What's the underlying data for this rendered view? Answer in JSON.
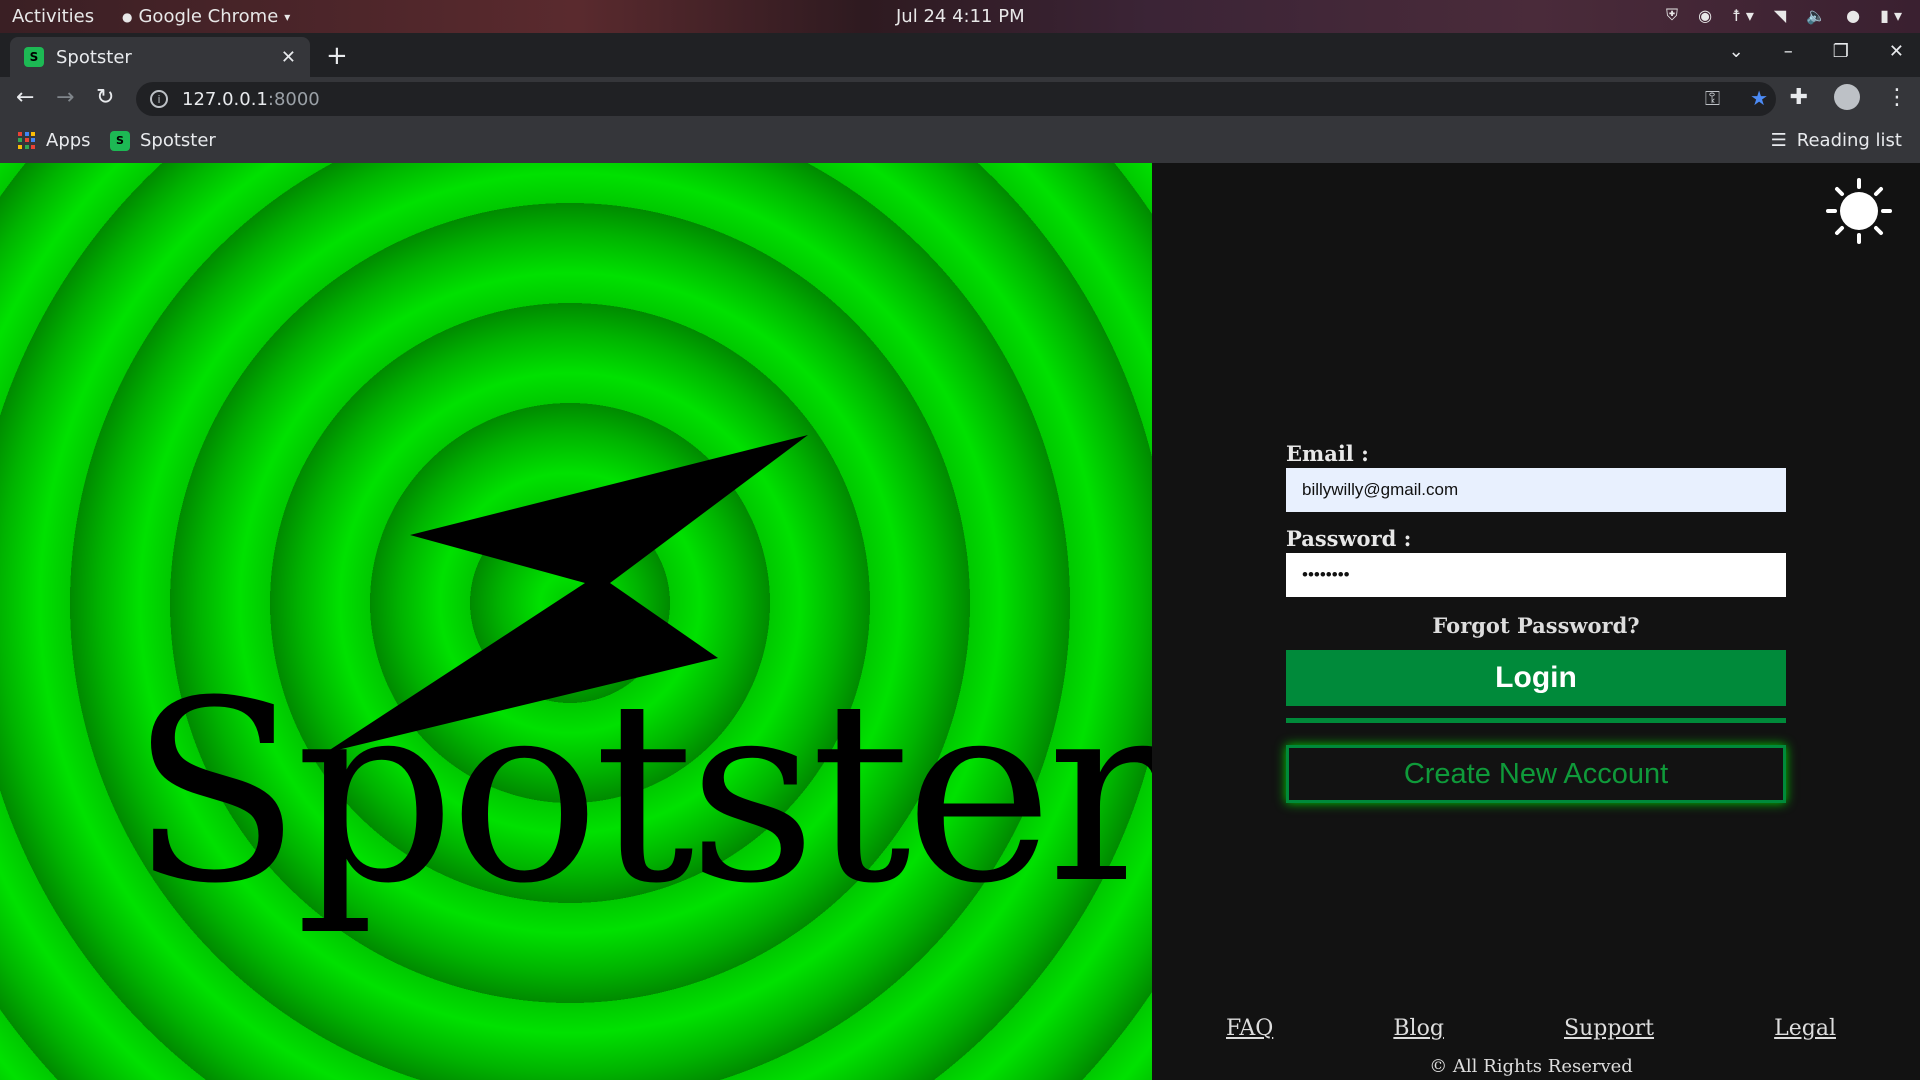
{
  "system_bar": {
    "activities": "Activities",
    "app_name": "Google Chrome",
    "clock": "Jul 24  4:11 PM"
  },
  "browser": {
    "tab_title": "Spotster",
    "url_host": "127.0.0.1",
    "url_port": ":8000",
    "bookmarks": [
      "Apps",
      "Spotster"
    ],
    "reading_list": "Reading list"
  },
  "hero": {
    "brand": "Spotster",
    "colors": {
      "ring_light": "#00e100",
      "ring_dark": "#008a00",
      "logo": "#000000"
    }
  },
  "theme_toggle_icon": "sun-icon",
  "login_form": {
    "email_label": "Email :",
    "email_value": "billywilly@gmail.com",
    "password_label": "Password :",
    "password_value": "••••••••",
    "forgot_password": "Forgot Password?",
    "login_button": "Login",
    "create_account_button": "Create New Account",
    "accent_color": "#008a3a"
  },
  "footer": {
    "links": [
      "FAQ",
      "Blog",
      "Support",
      "Legal"
    ],
    "copyright": "© All Rights Reserved"
  }
}
